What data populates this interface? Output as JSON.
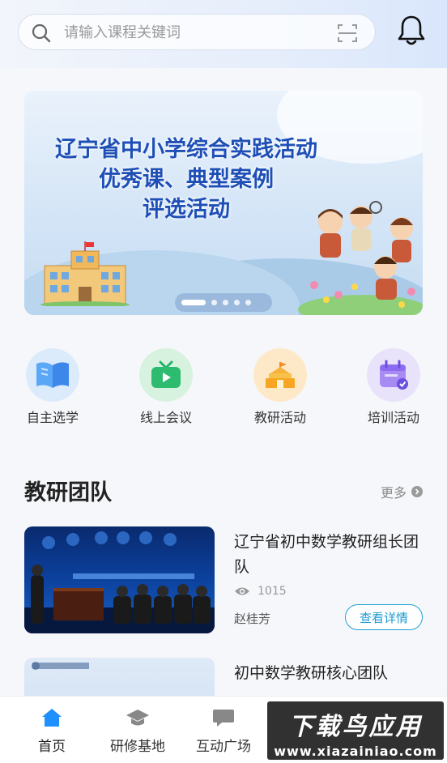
{
  "search": {
    "placeholder": "请输入课程关键词"
  },
  "banner": {
    "title_lines": [
      "辽宁省中小学综合实践活动",
      "优秀课、典型案例",
      "评选活动"
    ]
  },
  "quick_actions": [
    {
      "label": "自主选学",
      "icon": "book-icon",
      "color": "#3f8df0"
    },
    {
      "label": "线上会议",
      "icon": "video-tv-icon",
      "color": "#27b36a"
    },
    {
      "label": "教研活动",
      "icon": "building-icon",
      "color": "#f5a623"
    },
    {
      "label": "培训活动",
      "icon": "calendar-check-icon",
      "color": "#8b6cf0"
    }
  ],
  "section": {
    "title": "教研团队",
    "more": "更多"
  },
  "teams": [
    {
      "title": "辽宁省初中数学教研组长团队",
      "views": "1015",
      "leader": "赵桂芳",
      "button": "查看详情"
    },
    {
      "title": "初中数学教研核心团队"
    }
  ],
  "tabbar": {
    "items": [
      {
        "label": "首页",
        "icon": "home-icon"
      },
      {
        "label": "研修基地",
        "icon": "graduation-cap-icon"
      },
      {
        "label": "互动广场",
        "icon": "chat-icon"
      }
    ]
  },
  "watermark": {
    "line1": "下载鸟应用",
    "line2": "www.xiazainiao.com"
  },
  "colors": {
    "accent": "#1e9ad2",
    "home_active": "#1e90ff"
  }
}
